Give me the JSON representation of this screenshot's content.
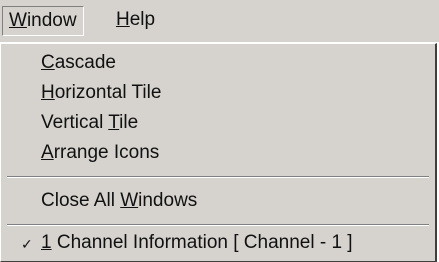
{
  "menubar": {
    "window": {
      "label_mnemonic": "W",
      "label_rest": "indow"
    },
    "help": {
      "label_mnemonic": "H",
      "label_rest": "elp"
    }
  },
  "dropdown": {
    "group1": [
      {
        "id": "cascade",
        "mnemonic": "C",
        "rest": "ascade"
      },
      {
        "id": "horizontal-tile",
        "mnemonic": "H",
        "rest": "orizontal Tile"
      },
      {
        "id": "vertical-tile",
        "pre": "Vertical ",
        "mnemonic": "T",
        "rest": "ile"
      },
      {
        "id": "arrange-icons",
        "mnemonic": "A",
        "rest": "rrange Icons"
      }
    ],
    "close_all": {
      "pre": "Close All ",
      "mnemonic": "W",
      "rest": "indows"
    },
    "channel": {
      "checked": true,
      "check_icon": "✓",
      "mnemonic": "1",
      "rest": " Channel Information [ Channel - 1 ]"
    }
  }
}
